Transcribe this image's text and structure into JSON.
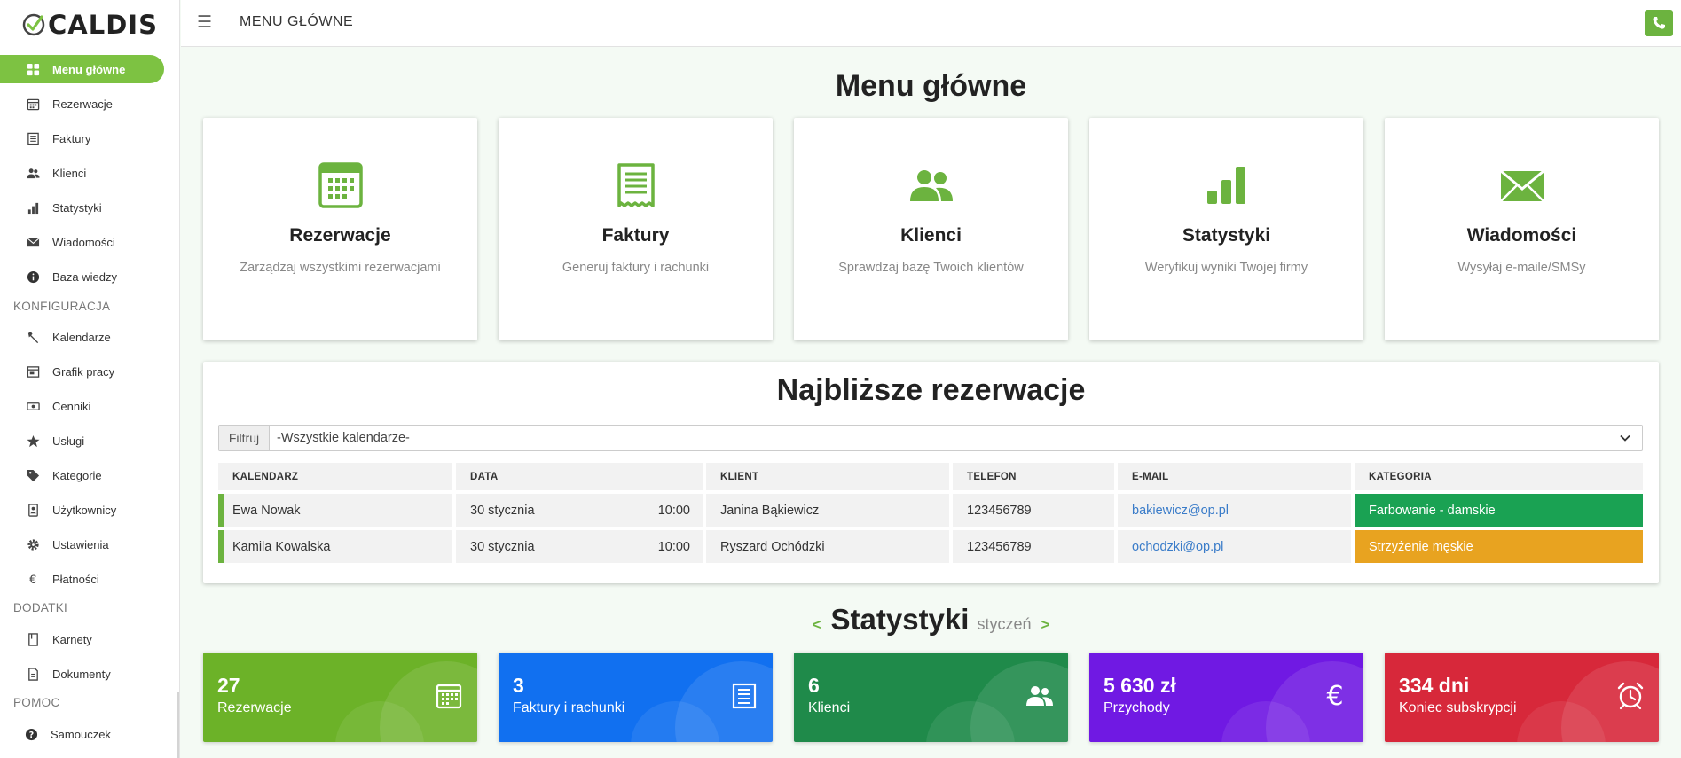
{
  "brand": {
    "logo_text": "CALDIS",
    "accent": "#7dc242"
  },
  "header": {
    "title": "MENU GŁÓWNE"
  },
  "sidebar": {
    "main_items": [
      {
        "label": "Menu główne",
        "icon": "grid-icon"
      },
      {
        "label": "Rezerwacje",
        "icon": "calendar-icon"
      },
      {
        "label": "Faktury",
        "icon": "invoice-icon"
      },
      {
        "label": "Klienci",
        "icon": "users-icon"
      },
      {
        "label": "Statystyki",
        "icon": "bar-chart-icon"
      },
      {
        "label": "Wiadomości",
        "icon": "envelope-icon"
      },
      {
        "label": "Baza wiedzy",
        "icon": "info-icon"
      }
    ],
    "section_config": "KONFIGURACJA",
    "config_items": [
      {
        "label": "Kalendarze",
        "icon": "wrench-icon"
      },
      {
        "label": "Grafik pracy",
        "icon": "schedule-icon"
      },
      {
        "label": "Cenniki",
        "icon": "money-icon"
      },
      {
        "label": "Usługi",
        "icon": "star-icon"
      },
      {
        "label": "Kategorie",
        "icon": "tag-icon"
      },
      {
        "label": "Użytkownicy",
        "icon": "user-badge-icon"
      },
      {
        "label": "Ustawienia",
        "icon": "gear-icon"
      },
      {
        "label": "Płatności",
        "icon": "euro-icon"
      }
    ],
    "section_addons": "DODATKI",
    "addon_items": [
      {
        "label": "Karnety",
        "icon": "pass-icon"
      },
      {
        "label": "Dokumenty",
        "icon": "document-icon"
      }
    ],
    "section_help": "POMOC",
    "help_items": [
      {
        "label": "Samouczek",
        "icon": "question-icon"
      }
    ]
  },
  "main": {
    "title": "Menu główne",
    "cards": [
      {
        "title": "Rezerwacje",
        "desc": "Zarządzaj wszystkimi rezerwacjami"
      },
      {
        "title": "Faktury",
        "desc": "Generuj faktury i rachunki"
      },
      {
        "title": "Klienci",
        "desc": "Sprawdzaj bazę Twoich klientów"
      },
      {
        "title": "Statystyki",
        "desc": "Weryfikuj wyniki Twojej firmy"
      },
      {
        "title": "Wiadomości",
        "desc": "Wysyłaj e-maile/SMSy"
      }
    ]
  },
  "reservations": {
    "title": "Najbliższe rezerwacje",
    "filter_label": "Filtruj",
    "filter_value": "-Wszystkie kalendarze-",
    "columns": [
      "KALENDARZ",
      "DATA",
      "KLIENT",
      "TELEFON",
      "E-MAIL",
      "KATEGORIA"
    ],
    "rows": [
      {
        "calendar": "Ewa Nowak",
        "date": "30 stycznia",
        "time": "10:00",
        "client": "Janina Bąkiewicz",
        "phone": "123456789",
        "email": "bakiewicz@op.pl",
        "category": "Farbowanie - damskie",
        "category_color": "#1aa253"
      },
      {
        "calendar": "Kamila Kowalska",
        "date": "30 stycznia",
        "time": "10:00",
        "client": "Ryszard Ochódzki",
        "phone": "123456789",
        "email": "ochodzki@op.pl",
        "category": "Strzyżenie męskie",
        "category_color": "#e8a320"
      }
    ]
  },
  "stats": {
    "prev": "<",
    "next": ">",
    "title": "Statystyki",
    "month": "styczeń",
    "tiles": [
      {
        "value": "27",
        "label": "Rezerwacje",
        "color": "#6cb228",
        "icon": "calendar-icon"
      },
      {
        "value": "3",
        "label": "Faktury i rachunki",
        "color": "#1170f0",
        "icon": "invoice-icon"
      },
      {
        "value": "6",
        "label": "Klienci",
        "color": "#1f8a4a",
        "icon": "users-icon"
      },
      {
        "value": "5 630 zł",
        "label": "Przychody",
        "color": "#7019e3",
        "icon": "euro-icon"
      },
      {
        "value": "334 dni",
        "label": "Koniec subskrypcji",
        "color": "#d7283a",
        "icon": "alarm-clock-icon"
      }
    ]
  }
}
